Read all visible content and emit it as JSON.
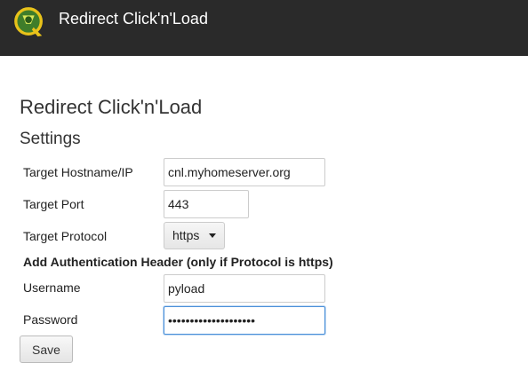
{
  "app": {
    "title": "Redirect Click'n'Load",
    "logo_icon": "pyload-logo-icon"
  },
  "page": {
    "title": "Redirect Click'n'Load",
    "section": "Settings"
  },
  "form": {
    "hostname": {
      "label": "Target Hostname/IP",
      "value": "cnl.myhomeserver.org"
    },
    "port": {
      "label": "Target Port",
      "value": "443"
    },
    "protocol": {
      "label": "Target Protocol",
      "value": "https"
    },
    "auth_heading": "Add Authentication Header (only if Protocol is https)",
    "username": {
      "label": "Username",
      "value": "pyload"
    },
    "password": {
      "label": "Password",
      "value": "••••••••••••••••••••"
    },
    "save_label": "Save"
  },
  "colors": {
    "header_bg": "#2a2a2a",
    "focus_border": "#4a90d9"
  }
}
